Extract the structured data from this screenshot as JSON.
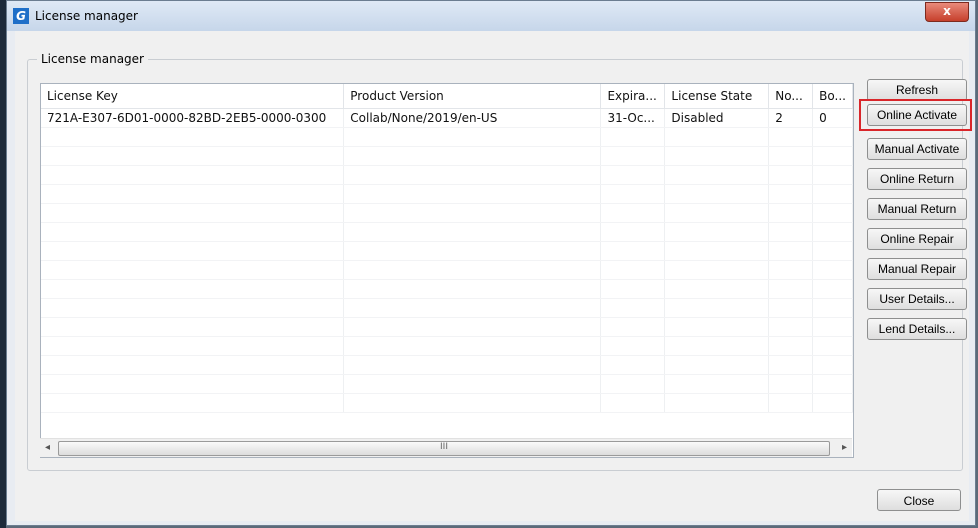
{
  "window": {
    "title": "License manager",
    "close_glyph": "x",
    "app_icon_letter": "G"
  },
  "group": {
    "label": "License manager"
  },
  "table": {
    "columns": [
      "License Key",
      "Product Version",
      "Expira...",
      "License State",
      "No...",
      "Bo..."
    ],
    "rows": [
      [
        "721A-E307-6D01-0000-82BD-2EB5-0000-0300",
        "Collab/None/2019/en-US",
        "31-Oc...",
        "Disabled",
        "2",
        "0"
      ]
    ],
    "empty_rows": 15
  },
  "scrollbar": {
    "left_arrow": "◂",
    "right_arrow": "▸",
    "thumb_grip": "III"
  },
  "buttons": {
    "refresh": "Refresh",
    "online_activate": "Online Activate",
    "manual_activate": "Manual Activate",
    "online_return": "Online Return",
    "manual_return": "Manual Return",
    "online_repair": "Online Repair",
    "manual_repair": "Manual Repair",
    "user_details": "User Details...",
    "lend_details": "Lend Details...",
    "close": "Close"
  },
  "colors": {
    "highlight": "#d9262a",
    "title_bg": "#c6d6ea",
    "close_red": "#c6402c"
  }
}
